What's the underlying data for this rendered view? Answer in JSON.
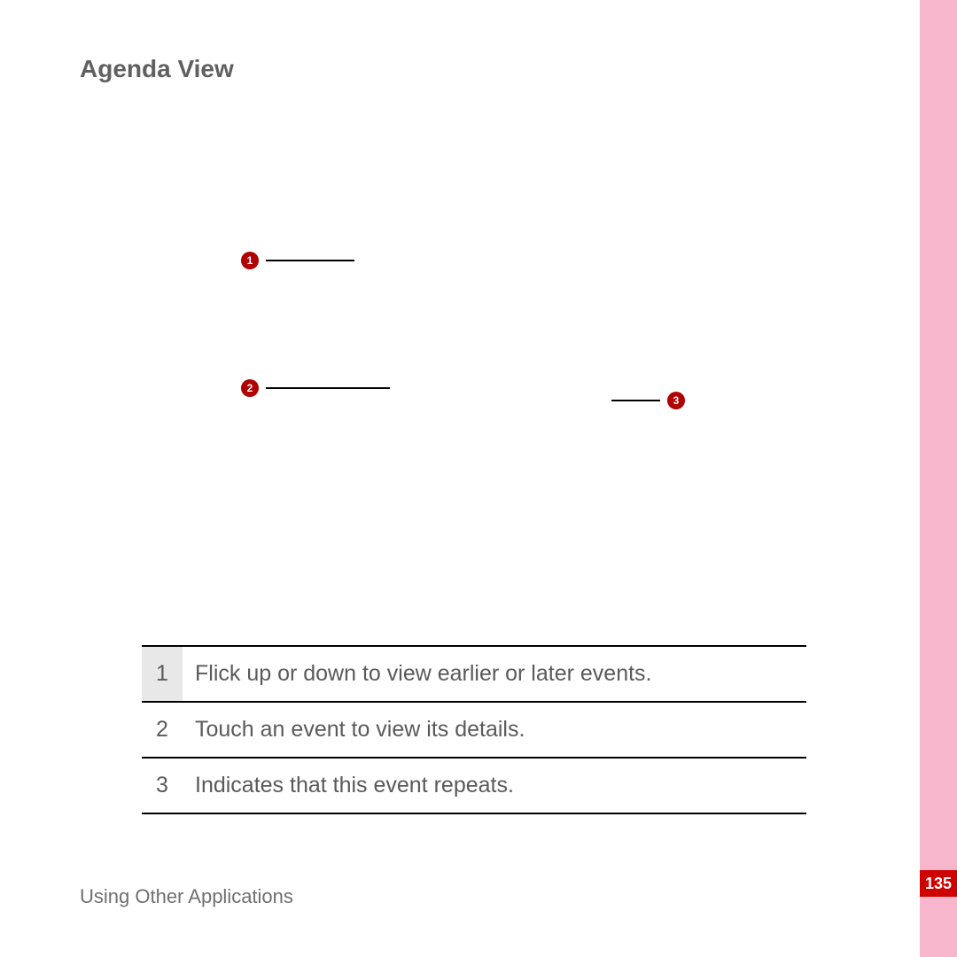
{
  "heading": "Agenda View",
  "callouts": {
    "c1": "1",
    "c2": "2",
    "c3": "3"
  },
  "legend": [
    {
      "num": "1",
      "desc": "Flick up or down to view earlier or later events."
    },
    {
      "num": "2",
      "desc": "Touch an event to view its details."
    },
    {
      "num": "3",
      "desc": "Indicates that this event repeats."
    }
  ],
  "footer": "Using Other Applications",
  "page_number": "135"
}
